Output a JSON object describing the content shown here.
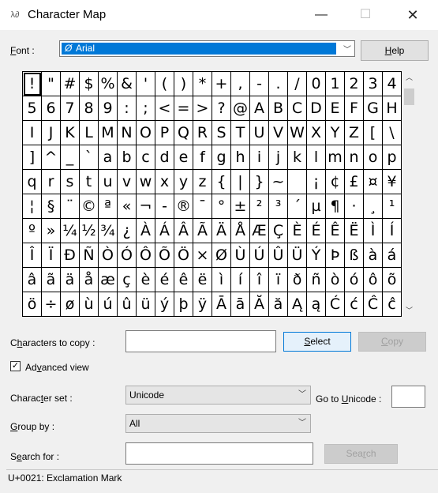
{
  "window": {
    "title": "Character Map",
    "icon": "character-map-app-icon",
    "minimize_glyph": "—",
    "maximize_glyph": "☐",
    "close_glyph": "✕"
  },
  "font": {
    "label_u": "F",
    "label_rest": "ont :",
    "value": "Arial",
    "icon_glyph": "Ø",
    "dropdown_glyph": "﹀"
  },
  "help": {
    "label_u": "H",
    "label_rest": "elp"
  },
  "grid": {
    "selected_index": 0,
    "chars": [
      "!",
      "\"",
      "#",
      "$",
      "%",
      "&",
      "'",
      "(",
      ")",
      "*",
      "+",
      ",",
      "-",
      ".",
      "/",
      "0",
      "1",
      "2",
      "3",
      "4",
      "5",
      "6",
      "7",
      "8",
      "9",
      ":",
      ";",
      "<",
      "=",
      ">",
      "?",
      "@",
      "A",
      "B",
      "C",
      "D",
      "E",
      "F",
      "G",
      "H",
      "I",
      "J",
      "K",
      "L",
      "M",
      "N",
      "O",
      "P",
      "Q",
      "R",
      "S",
      "T",
      "U",
      "V",
      "W",
      "X",
      "Y",
      "Z",
      "[",
      "\\",
      "]",
      "^",
      "_",
      "`",
      "a",
      "b",
      "c",
      "d",
      "e",
      "f",
      "g",
      "h",
      "i",
      "j",
      "k",
      "l",
      "m",
      "n",
      "o",
      "p",
      "q",
      "r",
      "s",
      "t",
      "u",
      "v",
      "w",
      "x",
      "y",
      "z",
      "{",
      "|",
      "}",
      "~",
      " ",
      "¡",
      "¢",
      "£",
      "¤",
      "¥",
      "¦",
      "§",
      "¨",
      "©",
      "ª",
      "«",
      "¬",
      "-",
      "®",
      "¯",
      "°",
      "±",
      "²",
      "³",
      "´",
      "µ",
      "¶",
      "·",
      "¸",
      "¹",
      "º",
      "»",
      "¼",
      "½",
      "¾",
      "¿",
      "À",
      "Á",
      "Â",
      "Ã",
      "Ä",
      "Å",
      "Æ",
      "Ç",
      "È",
      "É",
      "Ê",
      "Ë",
      "Ì",
      "Í",
      "Î",
      "Ï",
      "Ð",
      "Ñ",
      "Ò",
      "Ó",
      "Ô",
      "Õ",
      "Ö",
      "×",
      "Ø",
      "Ù",
      "Ú",
      "Û",
      "Ü",
      "Ý",
      "Þ",
      "ß",
      "à",
      "á",
      "â",
      "ã",
      "ä",
      "å",
      "æ",
      "ç",
      "è",
      "é",
      "ê",
      "ë",
      "ì",
      "í",
      "î",
      "ï",
      "ð",
      "ñ",
      "ò",
      "ó",
      "ô",
      "õ",
      "ö",
      "÷",
      "ø",
      "ù",
      "ú",
      "û",
      "ü",
      "ý",
      "þ",
      "ÿ",
      "Ā",
      "ā",
      "Ă",
      "ă",
      "Ą",
      "ą",
      "Ć",
      "ć",
      "Ĉ",
      "ĉ"
    ]
  },
  "scrollbar": {
    "up_glyph": "︿",
    "down_glyph": "﹀"
  },
  "copy": {
    "label_a": "C",
    "label_u": "h",
    "label_b": "aracters to copy :",
    "value": "",
    "select_u": "S",
    "select_rest": "elect",
    "copy_u": "C",
    "copy_rest": "opy"
  },
  "advanced": {
    "checked_glyph": "✓",
    "label_a": "Ad",
    "label_u": "v",
    "label_b": "anced view"
  },
  "charset": {
    "label_a": "Charac",
    "label_u": "t",
    "label_b": "er set :",
    "value": "Unicode",
    "goto_a": "Go to ",
    "goto_u": "U",
    "goto_b": "nicode :",
    "goto_value": ""
  },
  "groupby": {
    "label_u": "G",
    "label_rest": "roup by :",
    "value": "All"
  },
  "search": {
    "label_a": "S",
    "label_u": "e",
    "label_b": "arch for :",
    "value": "",
    "button_a": "Sea",
    "button_u": "r",
    "button_b": "ch"
  },
  "status": {
    "text": "U+0021: Exclamation Mark"
  }
}
